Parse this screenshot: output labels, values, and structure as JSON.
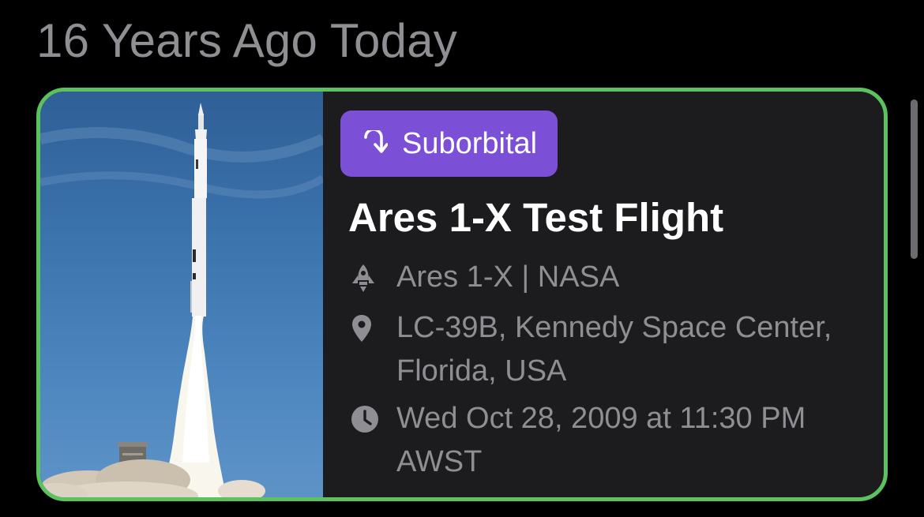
{
  "section": {
    "title": "16 Years Ago Today"
  },
  "card": {
    "image": {
      "subject": "Ares 1-X rocket launch photo"
    },
    "badge": {
      "icon": "redo-arrow-icon",
      "label": "Suborbital",
      "color": "#7b4fd6"
    },
    "title": "Ares 1-X Test Flight",
    "vehicle": {
      "icon": "rocket-icon",
      "text": "Ares 1-X | NASA"
    },
    "location": {
      "icon": "location-pin-icon",
      "text": "LC-39B, Kennedy Space Center, Florida, USA"
    },
    "time": {
      "icon": "clock-icon",
      "text": "Wed Oct 28, 2009 at 11:30 PM AWST"
    },
    "border_color": "#5bc25f"
  }
}
